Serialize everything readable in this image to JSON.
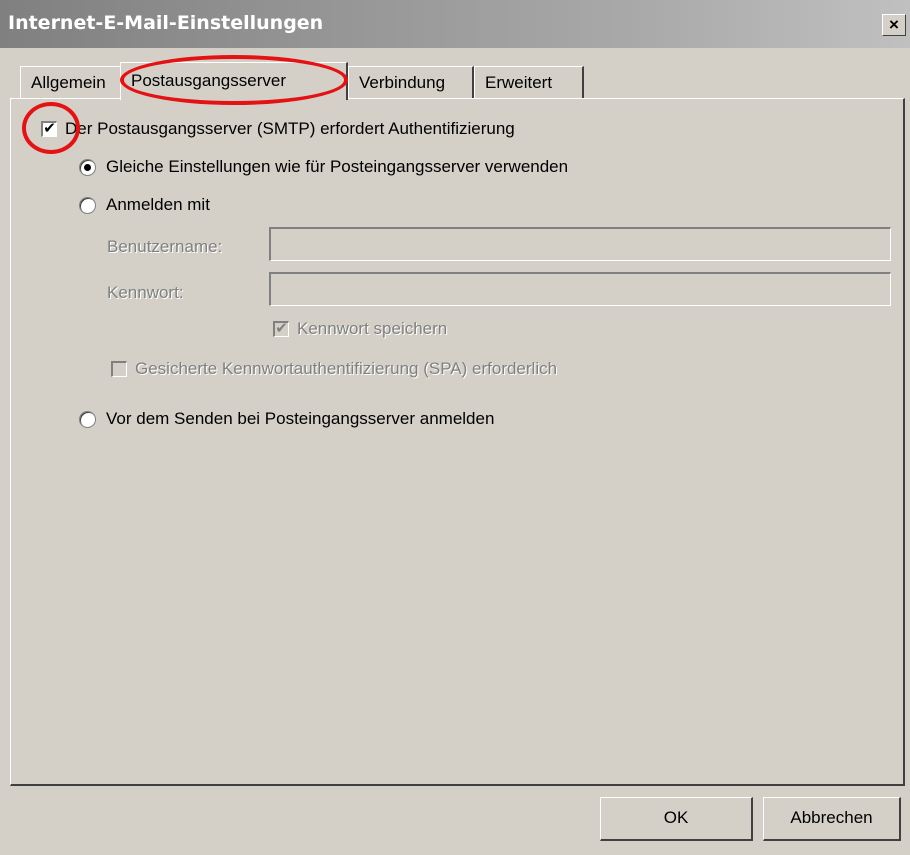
{
  "window": {
    "title": "Internet-E-Mail-Einstellungen",
    "close_glyph": "×"
  },
  "tabs": [
    {
      "label": "Allgemein",
      "active": false
    },
    {
      "label": "Postausgangsserver",
      "active": true
    },
    {
      "label": "Verbindung",
      "active": false
    },
    {
      "label": "Erweitert",
      "active": false
    }
  ],
  "panel": {
    "smtp_auth": {
      "label": "Der Postausgangsserver (SMTP) erfordert Authentifizierung",
      "checked": true,
      "mark": "✔"
    },
    "use_same_settings": {
      "label": "Gleiche Einstellungen wie für Posteingangsserver verwenden",
      "selected": true
    },
    "login_with": {
      "label": "Anmelden mit",
      "selected": false
    },
    "username": {
      "label": "Benutzername:",
      "value": ""
    },
    "password": {
      "label": "Kennwort:",
      "value": ""
    },
    "save_password": {
      "label": "Kennwort speichern",
      "checked": true,
      "mark": "✔"
    },
    "spa": {
      "label": "Gesicherte Kennwortauthentifizierung (SPA) erforderlich",
      "checked": false
    },
    "login_before_send": {
      "label": "Vor dem Senden bei Posteingangsserver anmelden",
      "selected": false
    }
  },
  "buttons": {
    "ok": "OK",
    "cancel": "Abbrechen"
  },
  "colors": {
    "dialog_bg": "#d4d0c8",
    "annotation": "#e41212"
  }
}
